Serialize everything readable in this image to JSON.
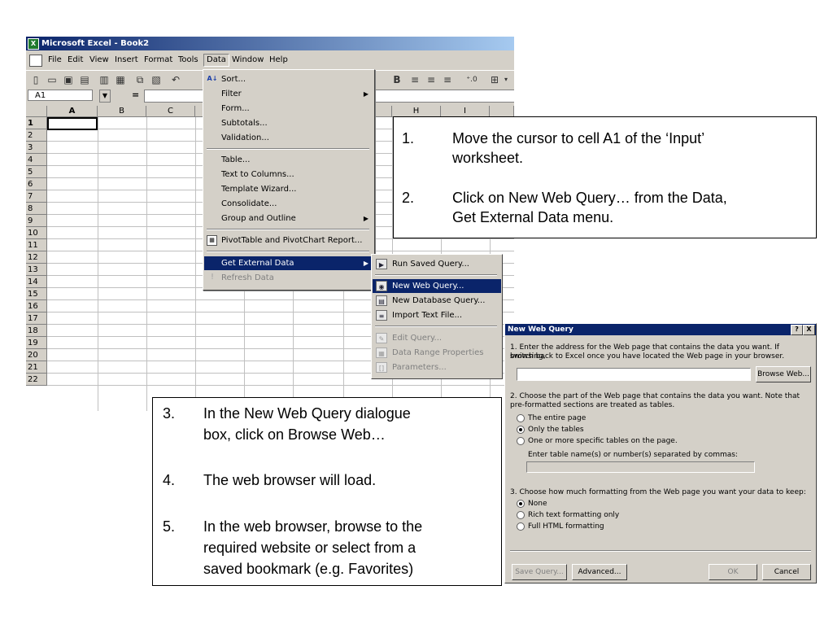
{
  "excel": {
    "title": "Microsoft Excel - Book2",
    "menus": [
      "File",
      "Edit",
      "View",
      "Insert",
      "Format",
      "Tools",
      "Data",
      "Window",
      "Help"
    ],
    "active_menu": "Data",
    "name_box": "A1",
    "formula_eq": "=",
    "columns": [
      "A",
      "B",
      "C",
      "H",
      "I"
    ],
    "rows": [
      "1",
      "2",
      "3",
      "4",
      "5",
      "6",
      "7",
      "8",
      "9",
      "10",
      "11",
      "12",
      "13",
      "14",
      "15",
      "16",
      "17",
      "18",
      "19",
      "20",
      "21",
      "22"
    ]
  },
  "data_menu": {
    "items": [
      {
        "label": "Sort...",
        "icon": "sort-az-icon"
      },
      {
        "label": "Filter",
        "submenu": true
      },
      {
        "label": "Form..."
      },
      {
        "label": "Subtotals..."
      },
      {
        "label": "Validation..."
      },
      {
        "label": "Table..."
      },
      {
        "label": "Text to Columns..."
      },
      {
        "label": "Template Wizard..."
      },
      {
        "label": "Consolidate..."
      },
      {
        "label": "Group and Outline",
        "submenu": true
      },
      {
        "label": "PivotTable and PivotChart Report...",
        "icon": "pivot-icon"
      },
      {
        "label": "Get External Data",
        "submenu": true,
        "highlighted": true
      },
      {
        "label": "Refresh Data",
        "disabled": true,
        "icon": "refresh-icon"
      }
    ]
  },
  "submenu": {
    "items": [
      {
        "label": "Run Saved Query...",
        "icon": "run-query-icon"
      },
      {
        "label": "New Web Query...",
        "icon": "web-query-icon",
        "highlighted": true
      },
      {
        "label": "New Database Query...",
        "icon": "database-query-icon"
      },
      {
        "label": "Import Text File...",
        "icon": "text-file-icon"
      },
      {
        "label": "Edit Query...",
        "disabled": true,
        "icon": "edit-query-icon"
      },
      {
        "label": "Data Range Properties",
        "disabled": true,
        "icon": "properties-icon"
      },
      {
        "label": "Parameters...",
        "disabled": true,
        "icon": "parameters-icon"
      }
    ]
  },
  "note1": {
    "steps": [
      {
        "num": "1.",
        "text1": "Move the cursor to cell A1 of the ‘Input’",
        "text2": "worksheet."
      },
      {
        "num": "2.",
        "text1": "Click on New Web Query… from the Data,",
        "text2": "Get External Data menu."
      }
    ]
  },
  "note2": {
    "steps": [
      {
        "num": "3.",
        "text1": "In the New Web Query dialogue",
        "text2": "box, click on Browse Web…",
        "text3": ""
      },
      {
        "num": "4.",
        "text1": "The web browser will load.",
        "text2": "",
        "text3": ""
      },
      {
        "num": "5.",
        "text1": "In the web browser, browse to the",
        "text2": "required website or select from a",
        "text3": "saved bookmark (e.g. Favorites)"
      }
    ]
  },
  "dialog": {
    "title": "New Web Query",
    "help_btn": "?",
    "close_btn": "X",
    "step1_a": "1. Enter the address for the Web page that contains the data you want.  If browsing,",
    "step1_b": "switch back to Excel once you have located the Web page in your browser.",
    "browse_label": "Browse Web...",
    "step2_a": "2. Choose the part of the Web page that contains the data you want.  Note that",
    "step2_b": "pre-formatted sections are treated as tables.",
    "radio_entire": "The entire page",
    "radio_tables": "Only the tables",
    "radio_specific": "One or more specific tables on the page.",
    "table_names_label": "Enter table name(s) or number(s) separated by commas:",
    "step3": "3. Choose how much formatting from the Web page you want your data to keep:",
    "radio_none": "None",
    "radio_rich": "Rich text formatting only",
    "radio_full": "Full HTML formatting",
    "save_query": "Save Query...",
    "advanced": "Advanced...",
    "ok": "OK",
    "cancel": "Cancel"
  }
}
